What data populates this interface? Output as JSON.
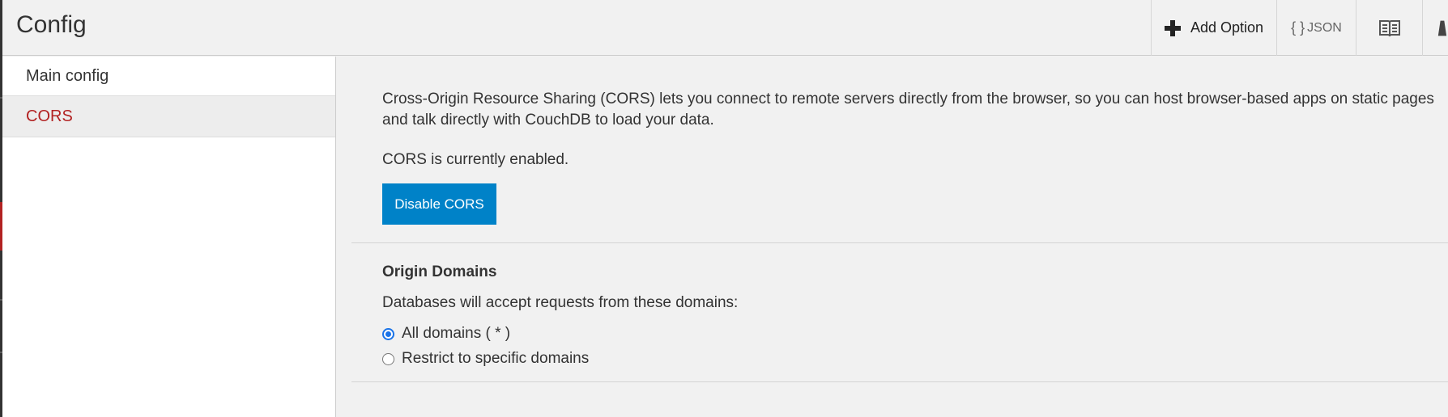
{
  "header": {
    "title": "Config",
    "toolbar": {
      "add_option_label": "Add Option",
      "json_braces": "{ }",
      "json_label": "JSON",
      "docs_icon": "book-icon",
      "more_icon": "notification-icon"
    }
  },
  "sidebar": {
    "items": [
      {
        "label": "Main config",
        "active": false
      },
      {
        "label": "CORS",
        "active": true
      }
    ]
  },
  "main": {
    "intro": "Cross-Origin Resource Sharing (CORS) lets you connect to remote servers directly from the browser, so you can host browser-based apps on static pages and talk directly with CouchDB to load your data.",
    "status": "CORS is currently enabled.",
    "disable_button": "Disable CORS",
    "origin": {
      "title": "Origin Domains",
      "description": "Databases will accept requests from these domains:",
      "options": [
        {
          "label": "All domains ( * )",
          "checked": true
        },
        {
          "label": "Restrict to specific domains",
          "checked": false
        }
      ]
    }
  },
  "colors": {
    "accent": "#0082c8",
    "active_nav": "#b22222",
    "radio": "#1a73e8"
  }
}
